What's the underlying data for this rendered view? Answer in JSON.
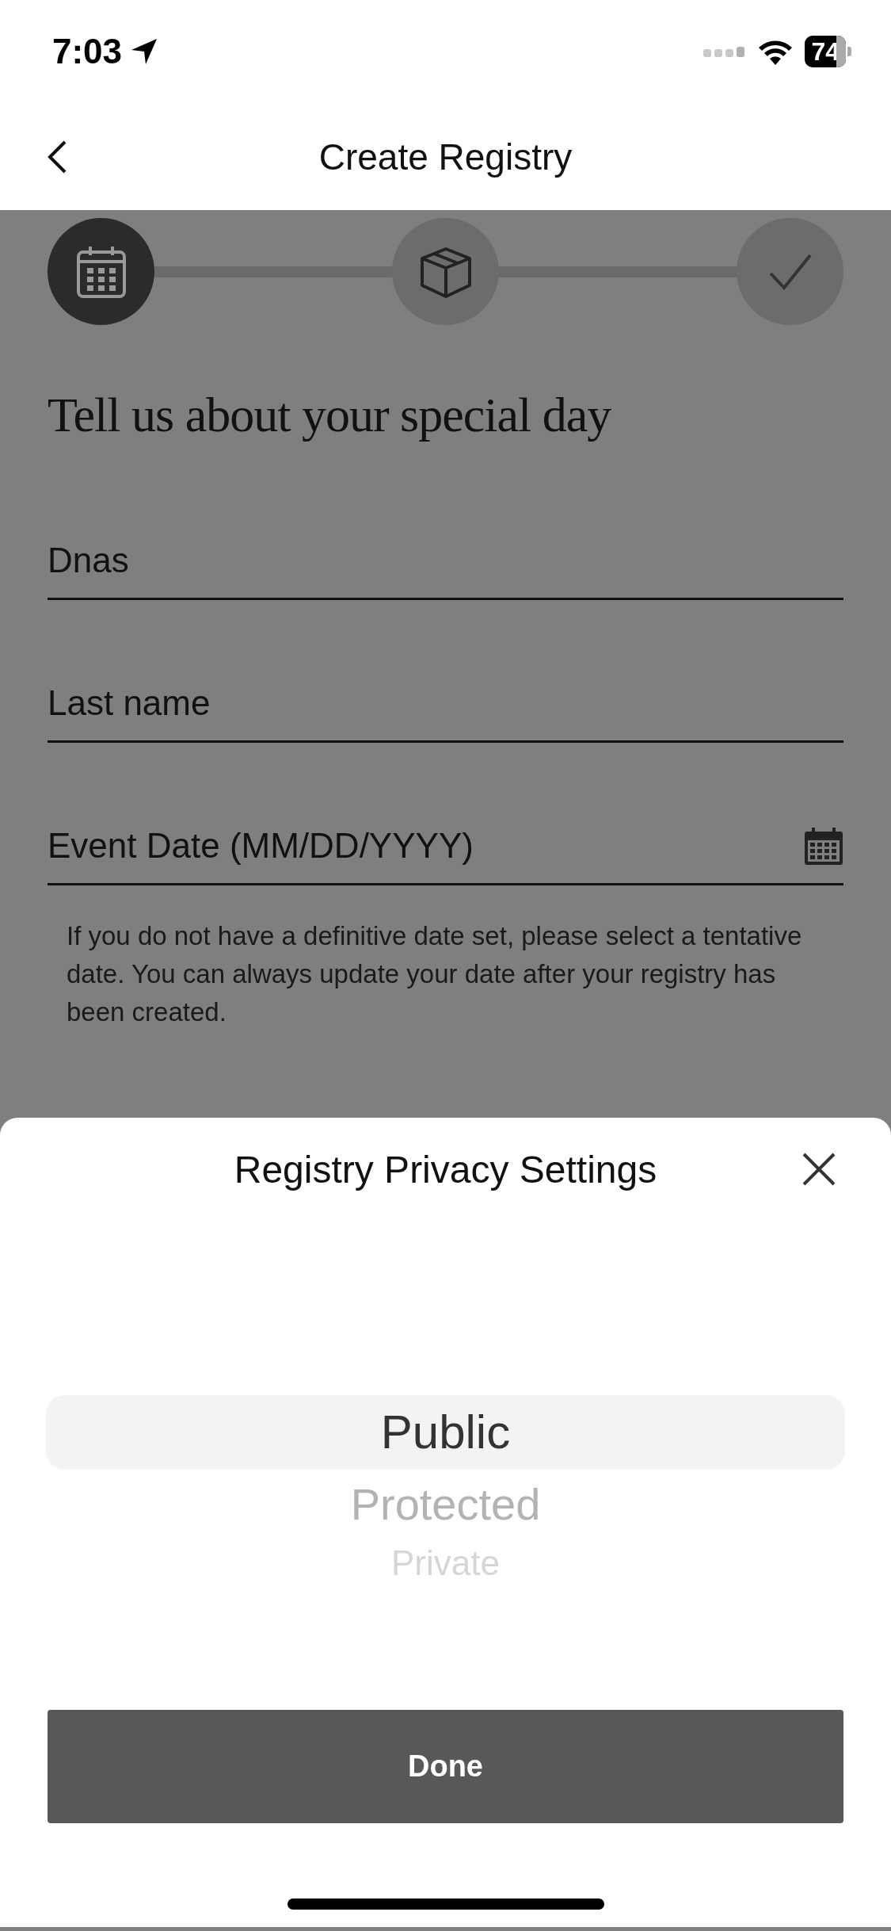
{
  "status_bar": {
    "time": "7:03",
    "battery": "74"
  },
  "header": {
    "title": "Create Registry"
  },
  "steps": [
    {
      "kind": "calendar",
      "selected": true
    },
    {
      "kind": "box",
      "selected": false
    },
    {
      "kind": "check",
      "selected": false
    }
  ],
  "heading": "Tell us about your special day",
  "fields": [
    {
      "kind": "text",
      "value": "Dnas"
    },
    {
      "kind": "text",
      "placeholder": "Last name"
    },
    {
      "kind": "date",
      "placeholder": "Event Date (MM/DD/YYYY)"
    }
  ],
  "note": "If you do not have a definitive date set, please select a tentative date. You can always update your date after your registry has been created.",
  "sheet": {
    "title": "Registry Privacy Settings",
    "options": [
      {
        "label": "Public",
        "selected": true
      },
      {
        "label": "Protected",
        "selected": false
      },
      {
        "label": "Private",
        "selected": false
      }
    ],
    "button": "Done"
  }
}
